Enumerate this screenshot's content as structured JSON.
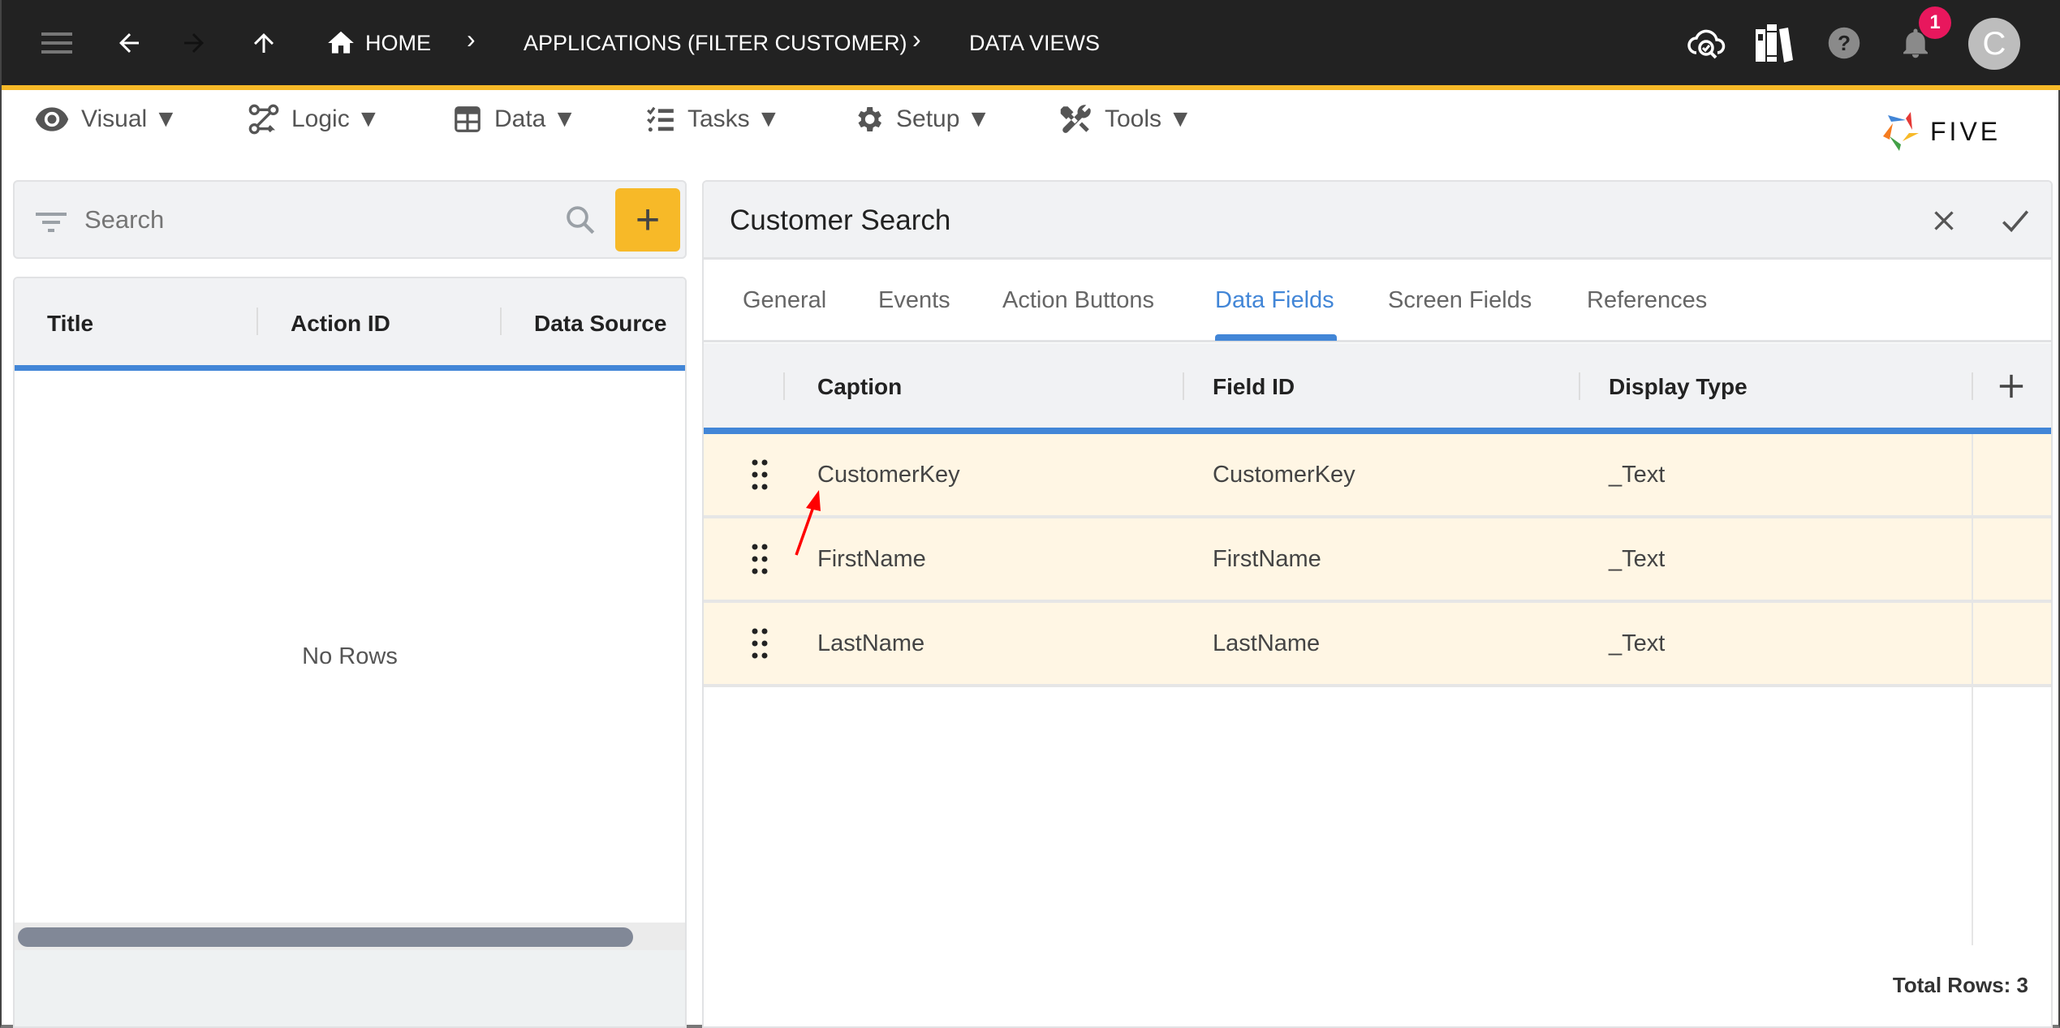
{
  "topbar": {
    "breadcrumbs": [
      "HOME",
      "APPLICATIONS (FILTER CUSTOMER)",
      "DATA VIEWS"
    ],
    "notification_count": "1",
    "avatar_initial": "C"
  },
  "menu": [
    {
      "label": "Visual ▼",
      "icon": "eye-icon"
    },
    {
      "label": "Logic ▼",
      "icon": "logic-flow-icon"
    },
    {
      "label": "Data ▼",
      "icon": "table-icon"
    },
    {
      "label": "Tasks ▼",
      "icon": "checklist-icon"
    },
    {
      "label": "Setup ▼",
      "icon": "gear-icon"
    },
    {
      "label": "Tools ▼",
      "icon": "tools-icon"
    }
  ],
  "brand": {
    "name": "FIVE"
  },
  "left_panel": {
    "search_placeholder": "Search",
    "add_label": "+",
    "columns": [
      "Title",
      "Action ID",
      "Data Source"
    ],
    "empty_text": "No Rows"
  },
  "right_panel": {
    "title": "Customer Search",
    "tabs": [
      "General",
      "Events",
      "Action Buttons",
      "Data Fields",
      "Screen Fields",
      "References"
    ],
    "active_tab": "Data Fields",
    "columns": [
      "Caption",
      "Field ID",
      "Display Type"
    ],
    "rows": [
      {
        "caption": "CustomerKey",
        "field_id": "CustomerKey",
        "display_type": "_Text"
      },
      {
        "caption": "FirstName",
        "field_id": "FirstName",
        "display_type": "_Text"
      },
      {
        "caption": "LastName",
        "field_id": "LastName",
        "display_type": "_Text"
      }
    ],
    "total_rows": "Total Rows: 3"
  },
  "colors": {
    "accent_yellow": "#f7b928",
    "accent_blue": "#4286d7",
    "row_highlight": "#fff6e4",
    "topbar": "#222222"
  }
}
